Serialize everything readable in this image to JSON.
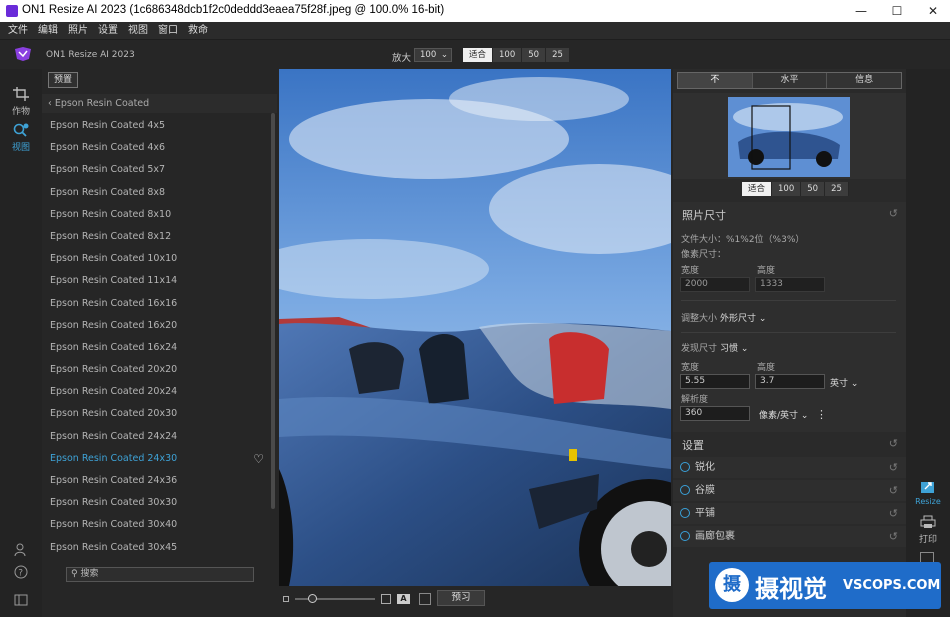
{
  "window": {
    "title": "ON1 Resize AI 2023 (1c686348dcb1f2c0deddd3eaea75f28f.jpeg @ 100.0% 16-bit)",
    "minimize": "—",
    "maximize": "☐",
    "close": "✕"
  },
  "menu": [
    "文件",
    "编辑",
    "照片",
    "设置",
    "视图",
    "窗口",
    "救命"
  ],
  "toolbar": {
    "app_name": "ON1 Resize AI 2023",
    "zoom_label": "放大",
    "zoom_value": "100",
    "zoom_presets": [
      "适合",
      "100",
      "50",
      "25"
    ]
  },
  "rail": {
    "crop_label": "作物",
    "view_label": "视图"
  },
  "presets": {
    "tab_label": "预置",
    "header": "Epson Resin Coated",
    "search_placeholder": "搜索",
    "items": [
      "Epson Resin Coated 4x5",
      "Epson Resin Coated 4x6",
      "Epson Resin Coated 5x7",
      "Epson Resin Coated 8x8",
      "Epson Resin Coated 8x10",
      "Epson Resin Coated 8x12",
      "Epson Resin Coated 10x10",
      "Epson Resin Coated 11x14",
      "Epson Resin Coated 16x16",
      "Epson Resin Coated 16x20",
      "Epson Resin Coated 16x24",
      "Epson Resin Coated 20x20",
      "Epson Resin Coated 20x24",
      "Epson Resin Coated 20x30",
      "Epson Resin Coated 24x24",
      "Epson Resin Coated 24x30",
      "Epson Resin Coated 24x36",
      "Epson Resin Coated 30x30",
      "Epson Resin Coated 30x40",
      "Epson Resin Coated 30x45"
    ],
    "active_index": 15
  },
  "bottom": {
    "preview_label": "预习",
    "text_icon": "A"
  },
  "right": {
    "tabs": [
      "不",
      "水平",
      "信息"
    ],
    "nav_zoom": [
      "适合",
      "100",
      "50",
      "25"
    ],
    "photo_size": {
      "title": "照片尺寸",
      "file_size": "文件大小：%1%2位（%3%）",
      "pixel_size": "像素尺寸：",
      "width_label": "宽度",
      "height_label": "高度",
      "width": "2000",
      "height": "1333"
    },
    "resize": {
      "label": "调整大小",
      "mode": "外形尺寸 ⌄"
    },
    "doc": {
      "label": "发现尺寸",
      "mode": "习惯 ⌄",
      "width_label": "宽度",
      "height_label": "高度",
      "width": "5.55",
      "height": "3.7",
      "unit": "英寸 ⌄",
      "res_label": "解析度",
      "res": "360",
      "res_unit": "像素/英寸 ⌄",
      "more": "⋮"
    },
    "settings": {
      "title": "设置",
      "items": [
        "锐化",
        "谷膜",
        "平铺",
        "画廊包裹"
      ]
    }
  },
  "modules": {
    "resize": "Resize",
    "print": "打印"
  },
  "watermark": {
    "text": "摄视觉",
    "site": "VSCOPS.COM",
    "glyph": "摄"
  }
}
